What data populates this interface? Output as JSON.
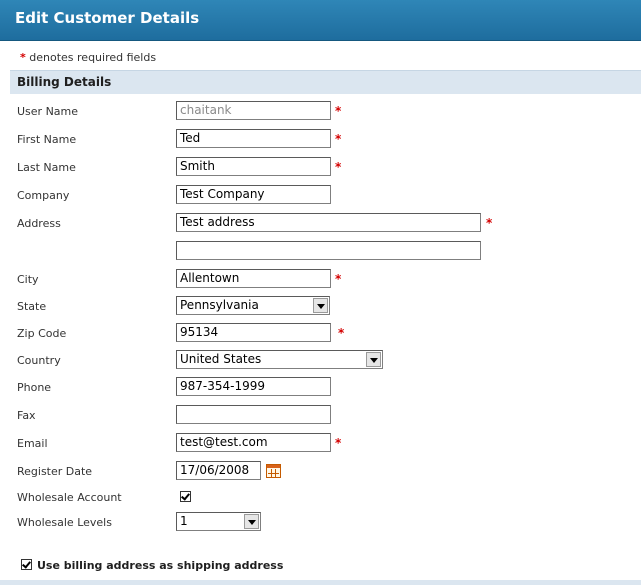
{
  "window": {
    "title": "Edit Customer Details"
  },
  "required_note": {
    "star": "*",
    "text": " denotes required fields"
  },
  "section": {
    "title": "Billing Details"
  },
  "fields": {
    "username": {
      "label": "User Name",
      "value": "chaitank",
      "disabled": true,
      "required": true
    },
    "first_name": {
      "label": "First Name",
      "value": "Ted",
      "required": true
    },
    "last_name": {
      "label": "Last Name",
      "value": "Smith",
      "required": true
    },
    "company": {
      "label": "Company",
      "value": "Test Company",
      "required": false
    },
    "address": {
      "label": "Address",
      "value": "Test address",
      "value2": "",
      "required": true
    },
    "city": {
      "label": "City",
      "value": "Allentown",
      "required": true
    },
    "state": {
      "label": "State",
      "selected": "Pennsylvania"
    },
    "zip": {
      "label": "Zip Code",
      "value": "95134",
      "required": true
    },
    "country": {
      "label": "Country",
      "selected": "United States"
    },
    "phone": {
      "label": "Phone",
      "value": "987-354-1999"
    },
    "fax": {
      "label": "Fax",
      "value": ""
    },
    "email": {
      "label": "Email",
      "value": "test@test.com",
      "required": true
    },
    "register_date": {
      "label": "Register Date",
      "value": "17/06/2008",
      "icon": "calendar-icon"
    },
    "wholesale_account": {
      "label": "Wholesale Account",
      "checked": true
    },
    "wholesale_levels": {
      "label": "Wholesale Levels",
      "selected": "1"
    }
  },
  "shipping": {
    "label": "Use billing address as shipping address",
    "checked": true
  },
  "required_star": "*",
  "colors": {
    "titlebar": "#1e6d9e",
    "section_header": "#dbe6f0",
    "required": "#d40000"
  }
}
